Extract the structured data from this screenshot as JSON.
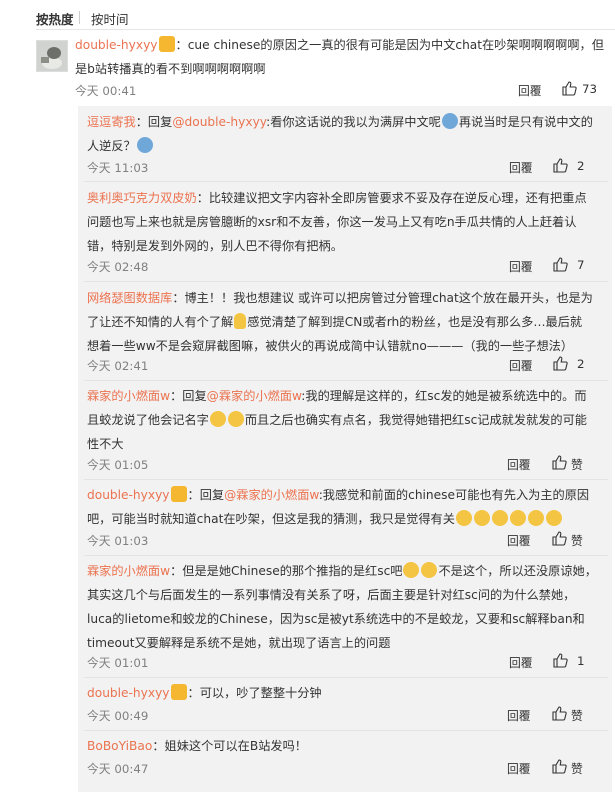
{
  "sort": {
    "hot": "按热度",
    "time": "按时间"
  },
  "main_comment": {
    "username": "double-hyxyy",
    "line1": "：cue chinese的原因之一真的很有可能是因为中文chat在吵架啊啊啊啊啊，但",
    "line2": "是b站转播真的看不到啊啊啊啊啊啊",
    "time": "今天 00:41",
    "reply_label": "回覆",
    "likes": "73"
  },
  "replies": [
    {
      "username": "逗逗寄我",
      "l1a": "：回复",
      "mention": "@double-hyxyy",
      "l1b": ":看你这话说的我以为满屏中文呢",
      "l1c": "再说当时是只有说中文的",
      "line2": "人逆反？",
      "time": "今天 11:03",
      "reply_label": "回覆",
      "likes": "2"
    },
    {
      "username": "奥利奥巧克力双皮奶",
      "line1": "：比较建议把文字内容补全即房管要求不妥及存在逆反心理，还有把重点",
      "line2": "问题也写上来也就是房管臆断的xsr和不友善，你这一发马上又有吃n手瓜共情的人上赶着认",
      "line3": "错，特别是发到外网的，别人巴不得你有把柄。",
      "time": "今天 02:48",
      "reply_label": "回覆",
      "likes": "7"
    },
    {
      "username": "网络瑟图数据库",
      "line1": "：博主！！我也想建议 或许可以把房管过分管理chat这个放在最开头，也是为",
      "l2a": "了让还不知情的人有个了解",
      "l2b": "感觉清楚了解到提CN或者rh的粉丝，也是没有那么多…最后就",
      "line3": "想着一些ww不是会窥屏截图嘛，被供火的再说成简中认错就no———（我的一些子想法）",
      "time": "今天 02:41",
      "reply_label": "回覆",
      "likes": "2"
    },
    {
      "username": "霖家的小燃面w",
      "l1a": "：回复",
      "mention": "@霖家的小燃面w",
      "l1b": ":我的理解是这样的，红sc发的她是被系统选中的。而",
      "l2a": "且蛟龙说了他会记名字",
      "l2b": "而且之后也确实有点名，我觉得她错把红sc记成就发就发的可能",
      "line3": "性不大",
      "time": "今天 01:05",
      "reply_label": "回覆",
      "likes": "赞"
    },
    {
      "username": "double-hyxyy",
      "l1a": "：回复",
      "mention": "@霖家的小燃面w",
      "l1b": ":我感觉和前面的chinese可能也有先入为主的原因",
      "line2": "吧，可能当时就知道chat在吵架，但这是我的猜测，我只是觉得有关",
      "time": "今天 01:03",
      "reply_label": "回覆",
      "likes": "赞"
    },
    {
      "username": "霖家的小燃面w",
      "l1a": "：但是是她Chinese的那个推指的是红sc吧",
      "l1b": "不是这个，所以还没原谅她，",
      "line2": "其实这几个与后面发生的一系列事情没有关系了呀，后面主要是针对红sc问的为什么禁她，",
      "line3": "luca的lietome和蛟龙的Chinese，因为sc是被yt系统选中的不是蛟龙，又要和sc解释ban和",
      "line4": "timeout又要解释是系统不是她，就出现了语言上的问题",
      "time": "今天 01:01",
      "reply_label": "回覆",
      "likes": "1"
    },
    {
      "username": "double-hyxyy",
      "line1": "：可以，吵了整整十分钟",
      "time": "今天 00:49",
      "reply_label": "回覆",
      "likes": "赞"
    },
    {
      "username": "BoBoYiBao",
      "line1": "：姐妹这个可以在B站发吗！",
      "time": "今天 00:47",
      "reply_label": "回覆",
      "likes": "赞"
    }
  ],
  "icons": {
    "like": "thumbs-up-icon",
    "user_badge": "fan-badge-icon"
  },
  "colors": {
    "username": "#eb7350",
    "meta": "#808080",
    "reply_bg": "#f2f2f2"
  }
}
